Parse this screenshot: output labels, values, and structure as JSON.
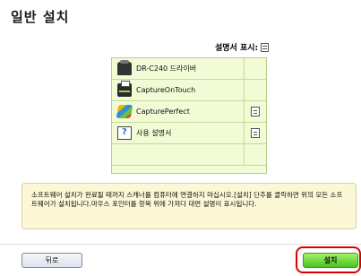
{
  "page": {
    "title": "일반 설치"
  },
  "manual_header": {
    "label": "설명서 표시:",
    "icon": "document-icon"
  },
  "software_list": [
    {
      "label": "DR-C240 드라이버",
      "icon": "scanner-icon",
      "has_manual": false
    },
    {
      "label": "CaptureOnTouch",
      "icon": "printer-icon",
      "has_manual": false
    },
    {
      "label": "CapturePerfect",
      "icon": "pen-icon",
      "has_manual": true
    },
    {
      "label": "사용 설명서",
      "icon": "manual-icon",
      "has_manual": true
    }
  ],
  "info": {
    "text": "소프트웨어 설치가 완료될 때까지 스캐너를 컴퓨터에 연결하지 마십시오.[설치] 단추를 클릭하면 위의 모든 소프트웨어가 설치됩니다.마우스 포인터를 항목 위에 가져다 대면 설명이 표시됩니다."
  },
  "buttons": {
    "back": "뒤로",
    "install": "설치"
  },
  "colors": {
    "list_bg": "#f1fbd6",
    "info_bg": "#fbf7d7",
    "install_green": "#45c61c",
    "highlight_red": "#d90000"
  }
}
